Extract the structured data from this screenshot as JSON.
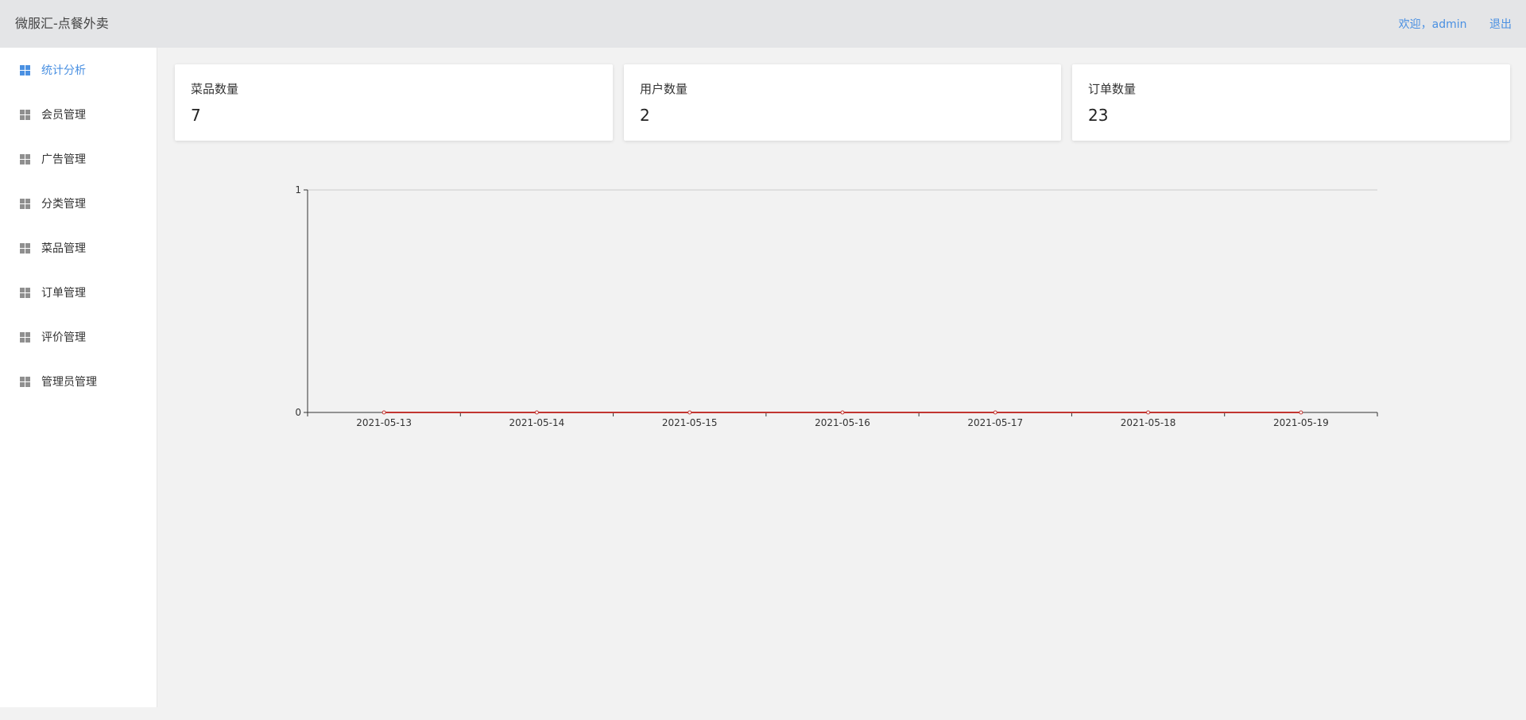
{
  "header": {
    "title": "微服汇-点餐外卖",
    "welcome": "欢迎，admin",
    "logout": "退出"
  },
  "sidebar": {
    "items": [
      {
        "label": "统计分析",
        "icon": "grid-icon",
        "active": true
      },
      {
        "label": "会员管理",
        "icon": "grid-icon",
        "active": false
      },
      {
        "label": "广告管理",
        "icon": "grid-icon",
        "active": false
      },
      {
        "label": "分类管理",
        "icon": "grid-icon",
        "active": false
      },
      {
        "label": "菜品管理",
        "icon": "grid-icon",
        "active": false
      },
      {
        "label": "订单管理",
        "icon": "grid-icon",
        "active": false
      },
      {
        "label": "评价管理",
        "icon": "grid-icon",
        "active": false
      },
      {
        "label": "管理员管理",
        "icon": "grid-icon",
        "active": false
      }
    ]
  },
  "stats": [
    {
      "label": "菜品数量",
      "value": "7"
    },
    {
      "label": "用户数量",
      "value": "2"
    },
    {
      "label": "订单数量",
      "value": "23"
    }
  ],
  "colors": {
    "accent": "#4a90e2",
    "line": "#c23531",
    "header_bg": "#e4e5e7",
    "content_bg": "#f2f2f2"
  },
  "chart_data": {
    "type": "line",
    "title": "",
    "xlabel": "",
    "ylabel": "",
    "x": [
      "2021-05-13",
      "2021-05-14",
      "2021-05-15",
      "2021-05-16",
      "2021-05-17",
      "2021-05-18",
      "2021-05-19"
    ],
    "series": [
      {
        "values": [
          0,
          0,
          0,
          0,
          0,
          0,
          0
        ]
      }
    ],
    "ylim": [
      0,
      1
    ],
    "yticks": [
      0,
      1
    ],
    "grid": true,
    "legend": "none"
  }
}
